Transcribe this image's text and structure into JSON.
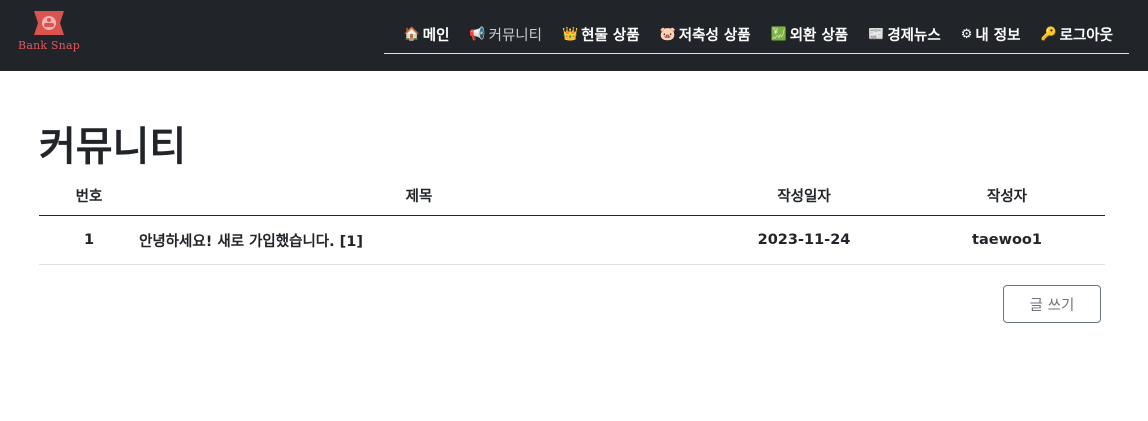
{
  "brand": {
    "name": "Bank Snap",
    "logo_icon": "piggy-bank-logo",
    "accent": "#e0555a"
  },
  "nav": {
    "items": [
      {
        "icon": "🏠",
        "icon_name": "house-icon",
        "label": "메인"
      },
      {
        "icon": "📢",
        "icon_name": "megaphone-icon",
        "label": "커뮤니티"
      },
      {
        "icon": "👑",
        "icon_name": "crown-icon",
        "label": "현물 상품"
      },
      {
        "icon": "🐷",
        "icon_name": "pig-icon",
        "label": "저축성 상품"
      },
      {
        "icon": "💹",
        "icon_name": "chart-icon",
        "label": "외환 상품"
      },
      {
        "icon": "📰",
        "icon_name": "newspaper-icon",
        "label": "경제뉴스"
      },
      {
        "icon": "⚙",
        "icon_name": "gear-icon",
        "label": "내 정보"
      },
      {
        "icon": "🔑",
        "icon_name": "key-icon",
        "label": "로그아웃"
      }
    ]
  },
  "page": {
    "title": "커뮤니티"
  },
  "table": {
    "headers": {
      "no": "번호",
      "title": "제목",
      "date": "작성일자",
      "author": "작성자"
    },
    "rows": [
      {
        "no": "1",
        "title": "안녕하세요! 새로 가입했습니다. [1]",
        "date": "2023-11-24",
        "author": "taewoo1"
      }
    ]
  },
  "actions": {
    "write_label": "글 쓰기"
  },
  "colors": {
    "navbar_bg": "#212529",
    "button_border": "#6c757d"
  }
}
